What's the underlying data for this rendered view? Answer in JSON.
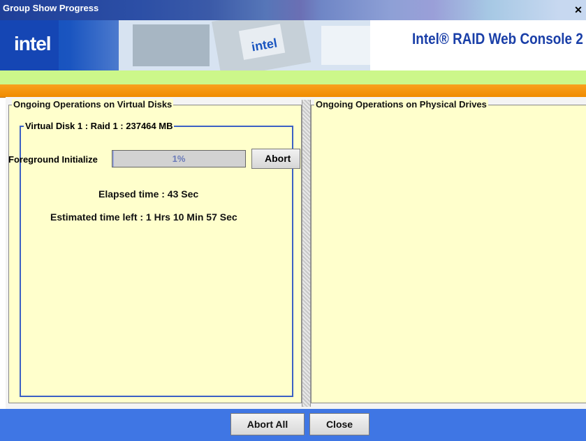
{
  "window": {
    "title": "Group Show Progress",
    "close_glyph": "✕"
  },
  "banner": {
    "logo_text": "intel",
    "console_title": "Intel® RAID Web Console 2"
  },
  "virtual_disks_panel": {
    "legend": "Ongoing Operations on Virtual Disks",
    "disk_legend": "Virtual Disk 1 : Raid 1 : 237464 MB",
    "operation_label": "Foreground Initialize",
    "progress_text": "1%",
    "progress_value": 0.01,
    "abort_label": "Abort",
    "elapsed": "Elapsed time : 43 Sec",
    "estimated": "Estimated time left : 1 Hrs 10 Min 57 Sec"
  },
  "physical_drives_panel": {
    "legend": "Ongoing Operations on Physical Drives"
  },
  "footer": {
    "abort_all_label": "Abort All",
    "close_label": "Close"
  },
  "colors": {
    "panel_bg": "#ffffcc",
    "accent_blue": "#3f76e4",
    "orange": "#f08b00",
    "green": "#ccf78a"
  }
}
